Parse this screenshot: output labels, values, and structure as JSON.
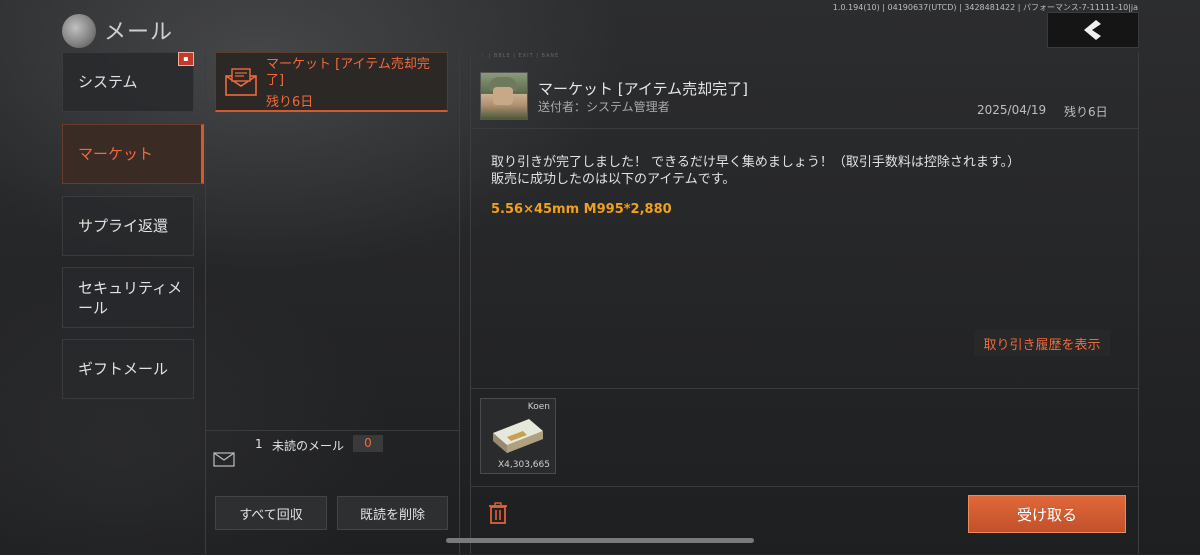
{
  "header": {
    "title": "メール",
    "version_text": "1.0.194(10) | 04190637(UTCD) | 3428481422 | パフォーマンス-7-11111-10|ja",
    "back_icon": "chevron-left-icon"
  },
  "categories": [
    {
      "label": "システム",
      "active": false
    },
    {
      "label": "マーケット",
      "active": true
    },
    {
      "label": "サプライ返還",
      "active": false
    },
    {
      "label": "セキュリティメール",
      "active": false
    },
    {
      "label": "ギフトメール",
      "active": false
    }
  ],
  "mail_list": {
    "items": [
      {
        "subject": "マーケット [アイテム売却完了]",
        "remaining": "残り6日",
        "icon": "envelope-icon"
      }
    ],
    "unread_count": "1",
    "unread_label": "未読のメール",
    "unread_badge": "0",
    "collect_all_label": "すべて回収",
    "delete_read_label": "既読を削除"
  },
  "detail": {
    "tag_left": "⋮ | BBLE | EXIT | BANE",
    "subject": "マーケット [アイテム売却完了]",
    "sender": "送付者：システム管理者",
    "date": "2025/04/19",
    "remaining": "残り6日",
    "body_line1": "取り引きが完了しました！ できるだけ早く集めましょう！（取引手数料は控除されます。）",
    "body_line2": "販売に成功したのは以下のアイテムです。",
    "item_line": "5.56×45mm M995*2,880",
    "history_label": "取り引き履歴を表示",
    "attachment": {
      "name": "Koen",
      "quantity": "X4,303,665",
      "icon": "money-stack-icon"
    },
    "receive_label": "受け取る",
    "delete_icon": "trash-icon"
  },
  "colors": {
    "accent": "#f06a3c",
    "item_highlight": "#f0a020",
    "background": "#232426"
  }
}
